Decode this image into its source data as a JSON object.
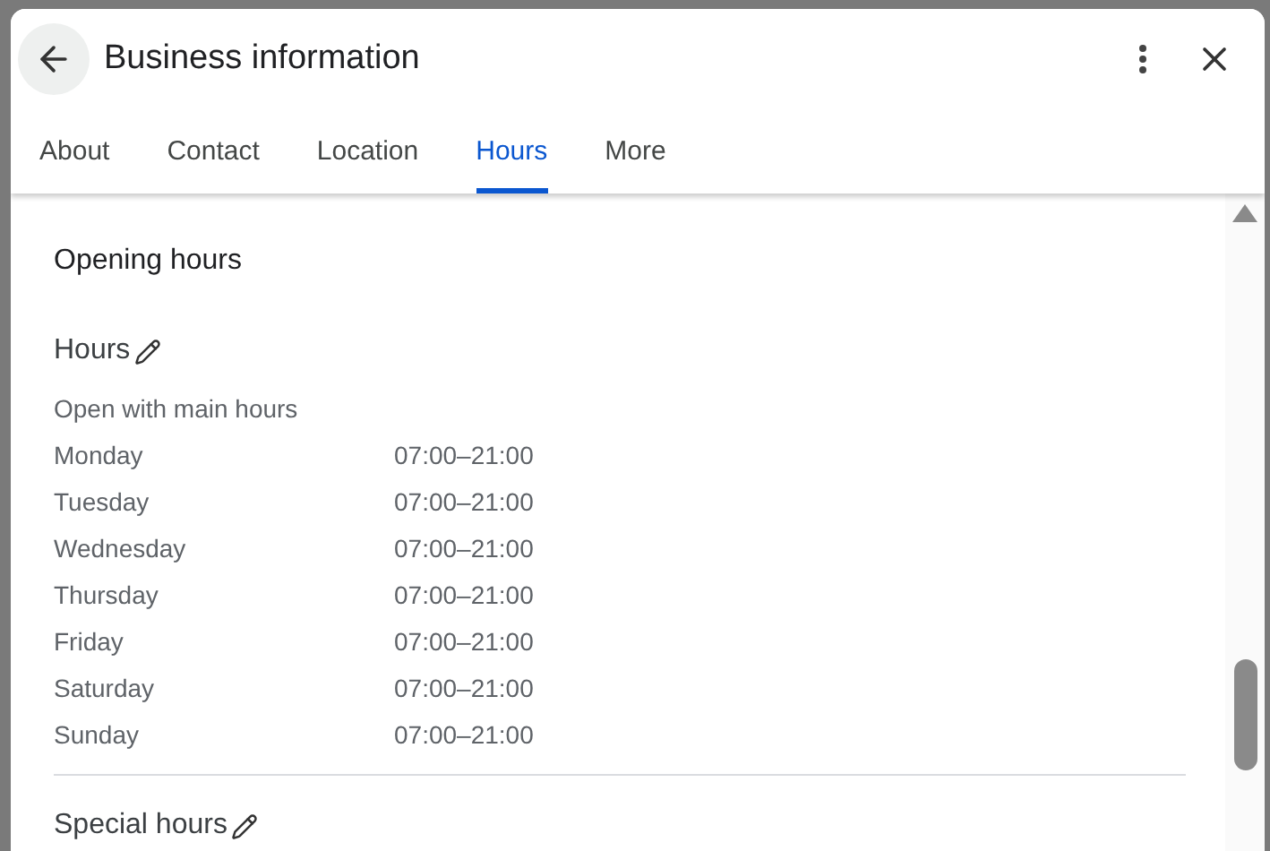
{
  "dialog": {
    "title": "Business information"
  },
  "tabs": [
    {
      "label": "About",
      "selected": false
    },
    {
      "label": "Contact",
      "selected": false
    },
    {
      "label": "Location",
      "selected": false
    },
    {
      "label": "Hours",
      "selected": true
    },
    {
      "label": "More",
      "selected": false
    }
  ],
  "section_title": "Opening hours",
  "hours": {
    "heading": "Hours",
    "status": "Open with main hours",
    "rows": [
      {
        "day": "Monday",
        "time": "07:00–21:00"
      },
      {
        "day": "Tuesday",
        "time": "07:00–21:00"
      },
      {
        "day": "Wednesday",
        "time": "07:00–21:00"
      },
      {
        "day": "Thursday",
        "time": "07:00–21:00"
      },
      {
        "day": "Friday",
        "time": "07:00–21:00"
      },
      {
        "day": "Saturday",
        "time": "07:00–21:00"
      },
      {
        "day": "Sunday",
        "time": "07:00–21:00"
      }
    ]
  },
  "special_hours": {
    "heading": "Special hours"
  }
}
